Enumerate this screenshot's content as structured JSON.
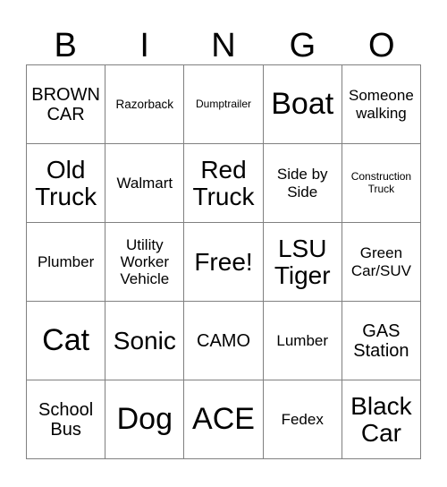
{
  "card": {
    "header_letters": [
      "B",
      "I",
      "N",
      "G",
      "O"
    ],
    "rows": [
      [
        {
          "text": "BROWN CAR",
          "size": "l"
        },
        {
          "text": "Razorback",
          "size": "s"
        },
        {
          "text": "Dumptrailer",
          "size": "xs"
        },
        {
          "text": "Boat",
          "size": "h"
        },
        {
          "text": "Someone walking",
          "size": "m"
        }
      ],
      [
        {
          "text": "Old Truck",
          "size": "xxl"
        },
        {
          "text": "Walmart",
          "size": "m"
        },
        {
          "text": "Red Truck",
          "size": "xxl"
        },
        {
          "text": "Side by Side",
          "size": "m"
        },
        {
          "text": "Construction Truck",
          "size": "xs"
        }
      ],
      [
        {
          "text": "Plumber",
          "size": "m"
        },
        {
          "text": "Utility Worker Vehicle",
          "size": "m"
        },
        {
          "text": "Free!",
          "size": "xxl"
        },
        {
          "text": "LSU Tiger",
          "size": "xxl"
        },
        {
          "text": "Green Car/SUV",
          "size": "m"
        }
      ],
      [
        {
          "text": "Cat",
          "size": "h"
        },
        {
          "text": "Sonic",
          "size": "xxl"
        },
        {
          "text": "CAMO",
          "size": "l"
        },
        {
          "text": "Lumber",
          "size": "m"
        },
        {
          "text": "GAS Station",
          "size": "l"
        }
      ],
      [
        {
          "text": "School Bus",
          "size": "l"
        },
        {
          "text": "Dog",
          "size": "h"
        },
        {
          "text": "ACE",
          "size": "h"
        },
        {
          "text": "Fedex",
          "size": "m"
        },
        {
          "text": "Black Car",
          "size": "xxl"
        }
      ]
    ]
  }
}
